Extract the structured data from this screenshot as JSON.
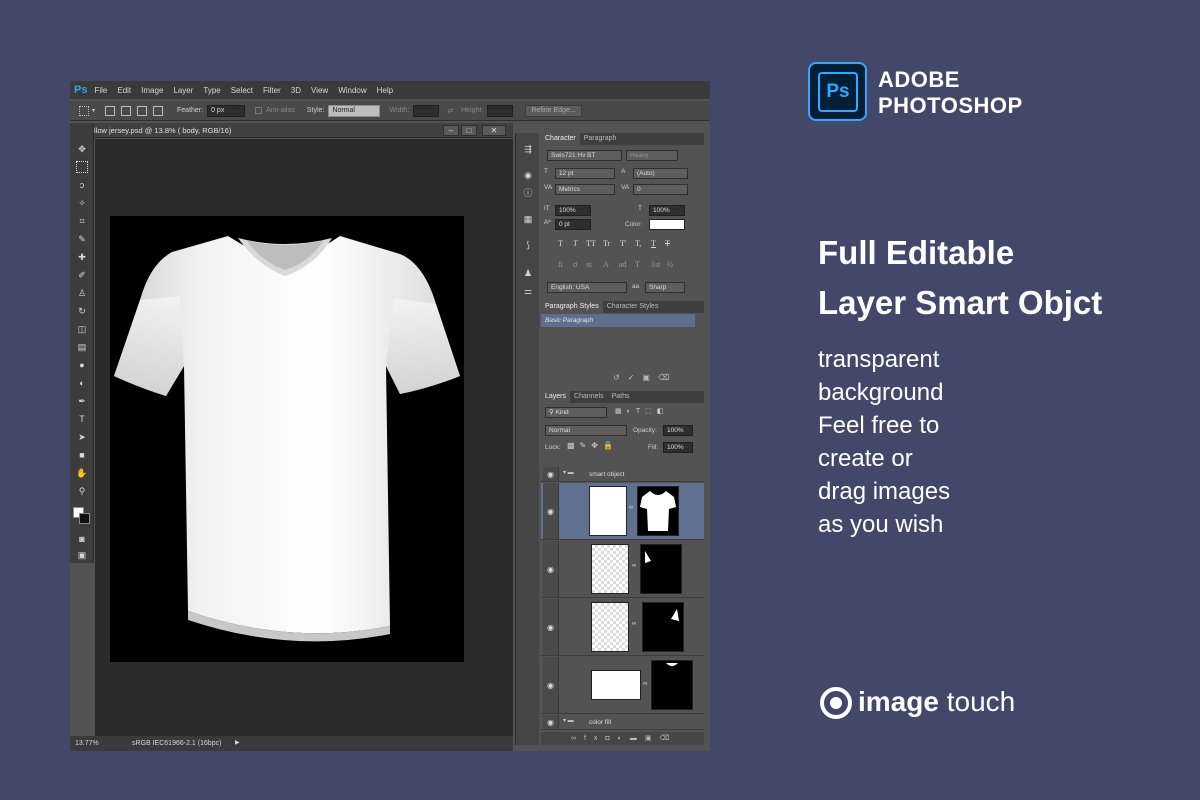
{
  "menubar": {
    "logo": "Ps",
    "items": [
      "File",
      "Edit",
      "Image",
      "Layer",
      "Type",
      "Select",
      "Filter",
      "3D",
      "View",
      "Window",
      "Help"
    ]
  },
  "options": {
    "feather_label": "Feather:",
    "feather_value": "0 px",
    "antialias_label": "Anti-alias",
    "style_label": "Style:",
    "style_value": "Normal",
    "width_label": "Width:",
    "height_label": "Height:",
    "refine_edge": "Refine Edge..."
  },
  "document": {
    "tab_title": "llow jersey.psd @ 13.8% ( body, RGB/16)",
    "zoom": "13.77%",
    "color_profile": "sRGB IEC61966-2.1 (16bpc)"
  },
  "character_panel": {
    "tabs": [
      "Character",
      "Paragraph"
    ],
    "font_family": "Swis721 Hv BT",
    "font_style": "Heavy",
    "font_size": "12 pt",
    "leading": "(Auto)",
    "kerning": "Metrics",
    "tracking": "0",
    "vertical_scale": "100%",
    "horizontal_scale": "100%",
    "baseline_shift": "0 pt",
    "color_label": "Color:",
    "language": "English: USA",
    "aa_icon": "aa",
    "antialias": "Sharp",
    "style_glyphs": [
      "T",
      "T",
      "TT",
      "Tr",
      "T'",
      "T,",
      "T",
      "T"
    ],
    "opentype_glyphs": [
      "fi",
      "ơ",
      "st",
      "A",
      "ad",
      "T",
      "1st",
      "½"
    ]
  },
  "paragraph_styles_panel": {
    "tabs": [
      "Paragraph Styles",
      "Character Styles"
    ],
    "items": [
      "Basic Paragraph"
    ]
  },
  "layers_panel": {
    "tabs": [
      "Layers",
      "Channels",
      "Paths"
    ],
    "filter_kind": "Kind",
    "blend_mode": "Normal",
    "opacity_label": "Opacity:",
    "opacity_value": "100%",
    "lock_label": "Lock:",
    "fill_label": "Fill:",
    "fill_value": "100%",
    "groups": [
      "smart object",
      "color fill"
    ]
  },
  "brand": {
    "logo_text": "Ps",
    "line1": "ADOBE",
    "line2": "PHOTOSHOP"
  },
  "headline": [
    "Full Editable",
    "Layer Smart Objct"
  ],
  "description": [
    "transparent",
    "background",
    "Feel free to",
    "create or",
    "drag images",
    "as you wish"
  ],
  "footer_logo": {
    "bold": "image",
    "normal": " touch"
  }
}
